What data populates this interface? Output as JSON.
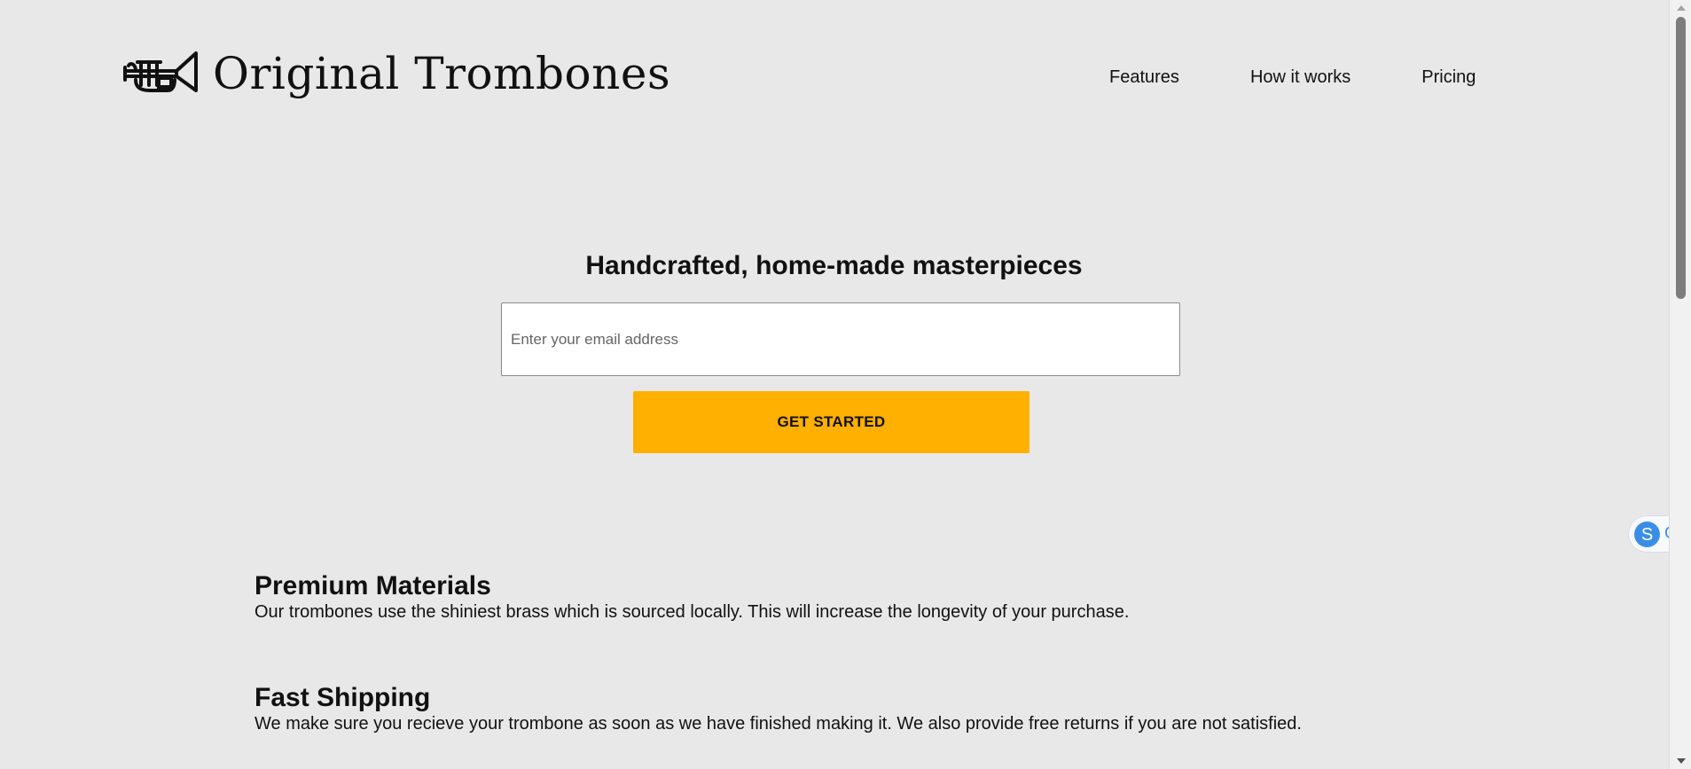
{
  "header": {
    "brand": "Original Trombones",
    "logo_icon": "trumpet-icon",
    "nav": [
      {
        "label": "Features"
      },
      {
        "label": "How it works"
      },
      {
        "label": "Pricing"
      }
    ]
  },
  "hero": {
    "title": "Handcrafted, home-made masterpieces",
    "email_placeholder": "Enter your email address",
    "email_value": "",
    "cta_label": "GET STARTED"
  },
  "features": [
    {
      "title": "Premium Materials",
      "text": "Our trombones use the shiniest brass which is sourced locally. This will increase the longevity of your purchase."
    },
    {
      "title": "Fast Shipping",
      "text": "We make sure you recieve your trombone as soon as we have finished making it. We also provide free returns if you are not satisfied."
    }
  ],
  "side_widget": {
    "badge": "S",
    "text": "G"
  },
  "colors": {
    "background": "#e8e8e8",
    "cta": "#ffb000",
    "widget_accent": "#3a8ee6"
  }
}
